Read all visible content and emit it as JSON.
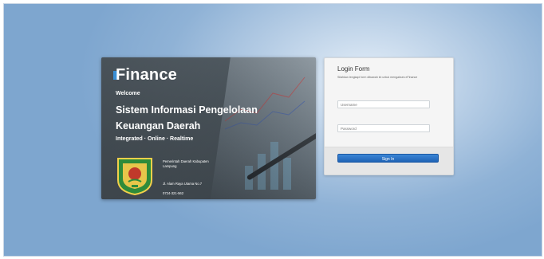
{
  "banner": {
    "brand": "Finance",
    "welcome": "Welcome",
    "title_line1": "Sistem Informasi Pengelolaan",
    "title_line2": "Keuangan Daerah",
    "tagline": "Integrated · Online · Realtime",
    "org_name": "Pemerintah Daerah Kabupaten",
    "org_region": "Lampung",
    "org_address": "Jl. Alam Raya Utama No.7",
    "org_phone": "0724-321-562"
  },
  "login": {
    "title": "Login Form",
    "subtitle": "Silahkan lengkapi form dibawah ini untuk mengakses eFinance",
    "username_placeholder": "Username",
    "password_placeholder": "Password",
    "signin_label": "Sign In"
  },
  "colors": {
    "accent": "#2a73c7",
    "background": "#8fb2d6"
  }
}
